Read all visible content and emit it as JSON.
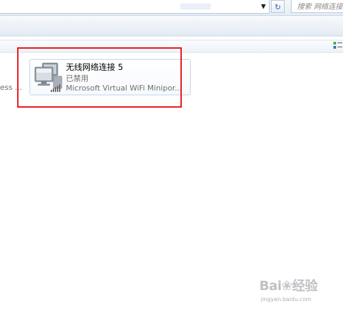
{
  "toolbar": {
    "dropdown_glyph": "▼",
    "refresh_glyph": "↻",
    "search_placeholder": "搜索 网络连接"
  },
  "left_clipped_label": "ess ...",
  "adapter": {
    "name": "无线网络连接 5",
    "status": "已禁用",
    "device": "Microsoft Virtual WiFi Minipor..."
  },
  "annotation": {
    "color": "#e8141b"
  },
  "watermark": {
    "brand_prefix": "Bai",
    "brand_paw": "❀",
    "brand_suffix": "经验",
    "url": "jingyan.baidu.com"
  },
  "icons": {
    "adapter_icon": "network-computers-icon",
    "signal_icon": "signal-bars-icon",
    "view_icon": "view-options-icon"
  }
}
